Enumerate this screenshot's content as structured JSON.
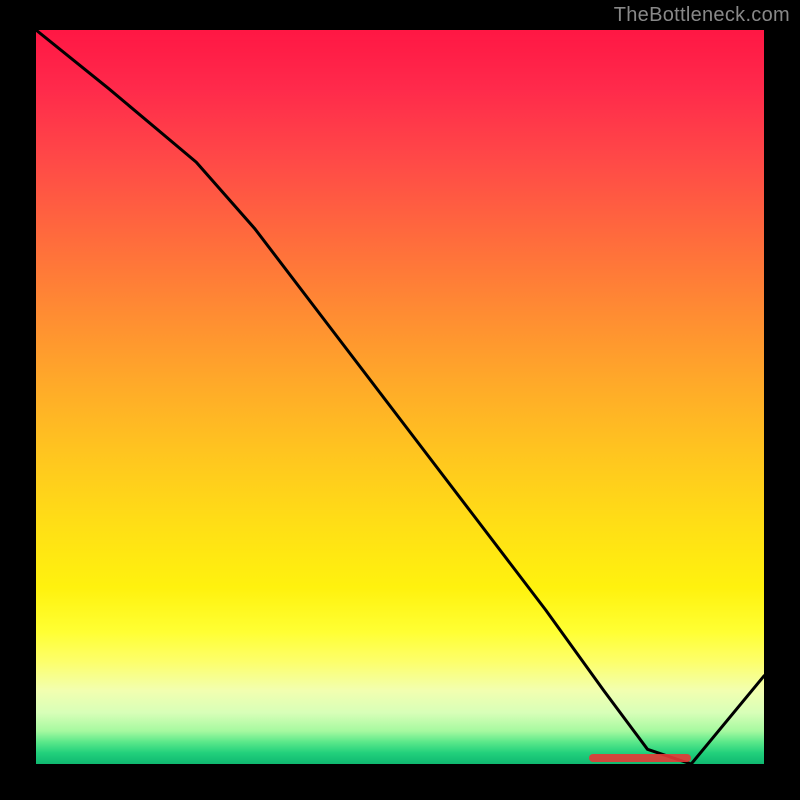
{
  "attribution": "TheBottleneck.com",
  "chart_data": {
    "type": "line",
    "title": "",
    "xlabel": "",
    "ylabel": "",
    "xlim": [
      0,
      100
    ],
    "ylim": [
      0,
      100
    ],
    "grid": false,
    "axes_visible": false,
    "background_gradient": {
      "stops": [
        {
          "pos": 0,
          "color": "#ff1744"
        },
        {
          "pos": 0.5,
          "color": "#ffc61f"
        },
        {
          "pos": 0.85,
          "color": "#ffff33"
        },
        {
          "pos": 1.0,
          "color": "#0fb870"
        }
      ]
    },
    "series": [
      {
        "name": "bottleneck-curve",
        "color": "#000000",
        "x": [
          0,
          10,
          22,
          30,
          40,
          50,
          60,
          70,
          78,
          84,
          90,
          100
        ],
        "y": [
          100,
          92,
          82,
          73,
          60,
          47,
          34,
          21,
          10,
          2,
          0,
          12
        ]
      }
    ],
    "markers": [
      {
        "name": "optimal-range",
        "color": "#e53935",
        "x_start": 76,
        "x_end": 90,
        "y": 0
      }
    ]
  }
}
